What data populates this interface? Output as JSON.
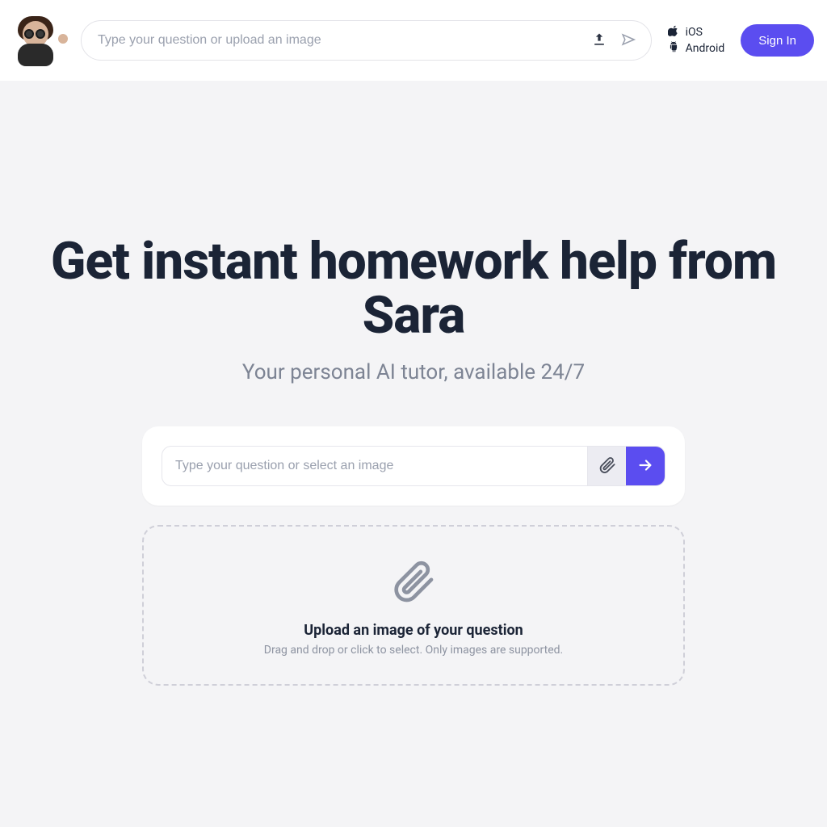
{
  "header": {
    "search_placeholder": "Type your question or upload an image",
    "ios_label": "iOS",
    "android_label": "Android",
    "signin_label": "Sign In"
  },
  "hero": {
    "title": "Get instant homework help from Sara",
    "subtitle": "Your personal AI tutor, available 24/7"
  },
  "question_box": {
    "placeholder": "Type your question or select an image"
  },
  "dropzone": {
    "title": "Upload an image of your question",
    "subtitle": "Drag and drop or click to select. Only images are supported."
  },
  "colors": {
    "accent": "#5b4df0"
  }
}
